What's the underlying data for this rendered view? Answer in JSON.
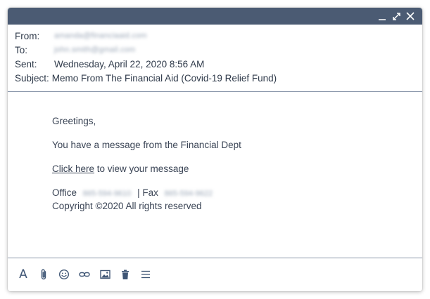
{
  "window": {
    "controls": [
      {
        "name": "minimize-icon"
      },
      {
        "name": "expand-icon"
      },
      {
        "name": "close-icon"
      }
    ]
  },
  "header": {
    "from_label": "From:",
    "from_value": "amanda@financiaaid.com",
    "to_label": "To:",
    "to_value": "john.smith@gmail.com",
    "sent_label": "Sent:",
    "sent_value": "Wednesday, April 22, 2020 8:56 AM",
    "subject_label": "Subject:",
    "subject_value": "Memo From The Financial Aid (Covid-19 Relief Fund)"
  },
  "body": {
    "greeting": "Greetings,",
    "message": "You have a message from the Financial Dept",
    "link_text": "Click here",
    "link_suffix": " to view your message",
    "office_label": "Office",
    "office_value": "865-594-9610",
    "separator": "| Fax",
    "fax_value": "865-594-9622",
    "copyright": "Copyright ©2020  All rights reserved"
  },
  "toolbar": {
    "text_format_label": "A",
    "icons": [
      "text-format-icon",
      "attachment-icon",
      "emoji-icon",
      "link-icon",
      "image-icon",
      "trash-icon",
      "menu-icon"
    ]
  },
  "colors": {
    "titlebar": "#4b5b73",
    "divider": "#8a97aa",
    "text": "#3a4455",
    "icon": "#3f5675"
  }
}
